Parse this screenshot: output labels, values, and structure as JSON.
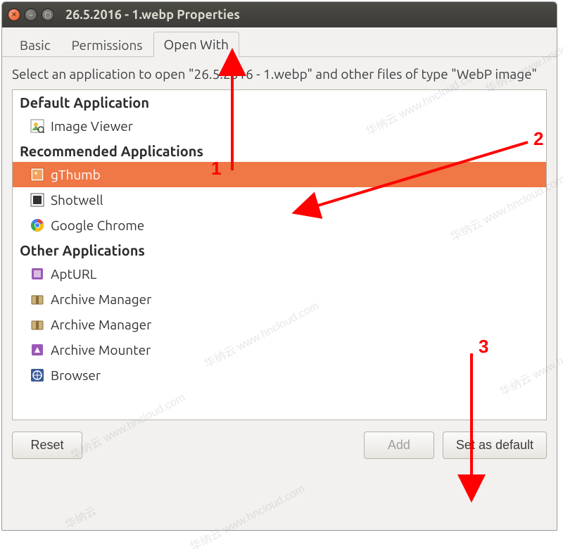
{
  "window": {
    "title": "26.5.2016 - 1.webp Properties"
  },
  "tabs": [
    {
      "label": "Basic",
      "active": false
    },
    {
      "label": "Permissions",
      "active": false
    },
    {
      "label": "Open With",
      "active": true
    }
  ],
  "instruction": "Select an application to open \"26.5.2016 - 1.webp\" and other files of type \"WebP image\"",
  "sections": {
    "default_header": "Default Application",
    "default_apps": [
      {
        "name": "Image Viewer",
        "icon": "image-viewer-icon",
        "selected": false
      }
    ],
    "recommended_header": "Recommended Applications",
    "recommended_apps": [
      {
        "name": "gThumb",
        "icon": "gthumb-icon",
        "selected": true
      },
      {
        "name": "Shotwell",
        "icon": "shotwell-icon",
        "selected": false
      },
      {
        "name": "Google Chrome",
        "icon": "chrome-icon",
        "selected": false
      }
    ],
    "other_header": "Other Applications",
    "other_apps": [
      {
        "name": "AptURL",
        "icon": "apturl-icon",
        "selected": false
      },
      {
        "name": "Archive Manager",
        "icon": "archive-manager-icon",
        "selected": false
      },
      {
        "name": "Archive Manager",
        "icon": "archive-manager-icon",
        "selected": false
      },
      {
        "name": "Archive Mounter",
        "icon": "archive-mounter-icon",
        "selected": false
      },
      {
        "name": "Browser",
        "icon": "browser-icon",
        "selected": false
      }
    ]
  },
  "buttons": {
    "reset": "Reset",
    "add": "Add",
    "set_default": "Set as default"
  },
  "annotations": {
    "n1": "1",
    "n2": "2",
    "n3": "3"
  },
  "watermark": {
    "text_cn": "华纳云",
    "text_en": "www.hncloud.com"
  },
  "colors": {
    "selection": "#f07746",
    "annotation": "#ff0000",
    "titlebar": "#3c3b37"
  }
}
